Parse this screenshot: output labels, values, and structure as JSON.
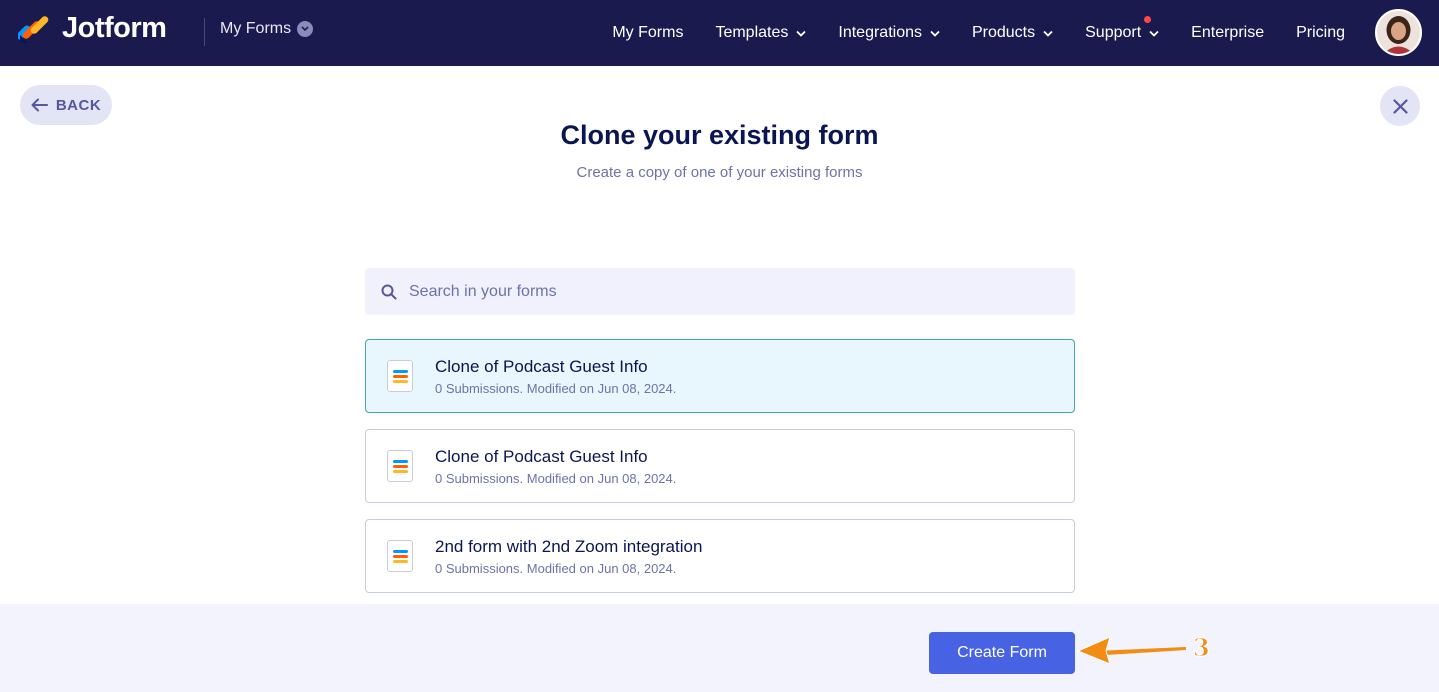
{
  "brand": {
    "name": "Jotform",
    "colors": {
      "nav_bg": "#1b1a4e",
      "primary": "#4763e4",
      "annotation": "#f28c13"
    }
  },
  "header": {
    "forms_switch_label": "My Forms",
    "nav": [
      "My Forms",
      "Templates",
      "Integrations",
      "Products",
      "Support",
      "Enterprise",
      "Pricing"
    ]
  },
  "page": {
    "back_label": "BACK",
    "title": "Clone your existing form",
    "subtitle": "Create a copy of one of your existing forms"
  },
  "search": {
    "placeholder": "Search in your forms",
    "value": ""
  },
  "forms": [
    {
      "name": "Clone of Podcast Guest Info",
      "meta": "0 Submissions. Modified on Jun 08, 2024.",
      "selected": true
    },
    {
      "name": "Clone of Podcast Guest Info",
      "meta": "0 Submissions. Modified on Jun 08, 2024.",
      "selected": false
    },
    {
      "name": "2nd form with 2nd Zoom integration",
      "meta": "0 Submissions. Modified on Jun 08, 2024.",
      "selected": false
    }
  ],
  "footer": {
    "create_label": "Create Form"
  },
  "annotation": {
    "step": "3"
  }
}
